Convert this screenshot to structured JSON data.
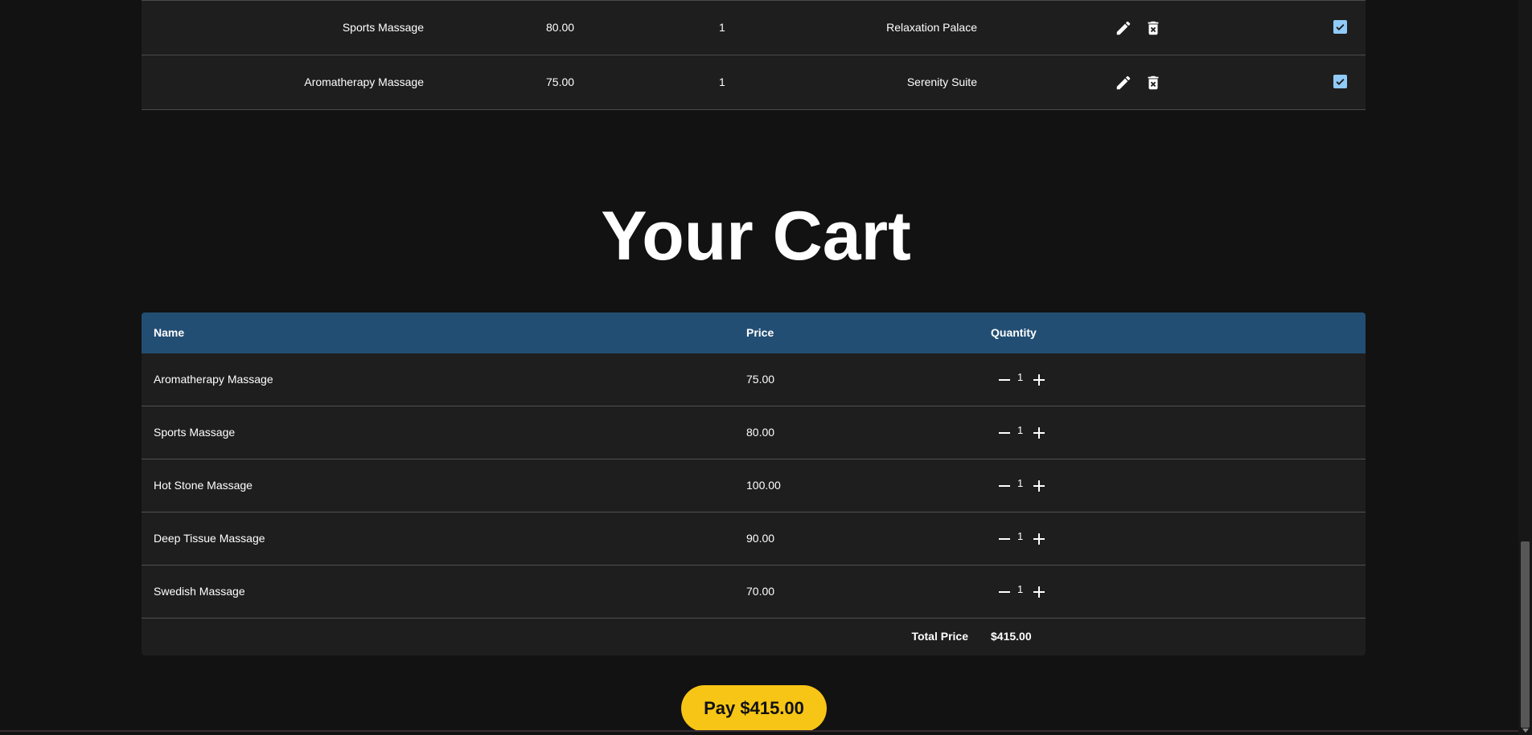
{
  "admin_table": {
    "rows": [
      {
        "name": "Sports Massage",
        "price": "80.00",
        "quantity": "1",
        "location": "Relaxation Palace",
        "checked": true
      },
      {
        "name": "Aromatherapy Massage",
        "price": "75.00",
        "quantity": "1",
        "location": "Serenity Suite",
        "checked": true
      }
    ]
  },
  "cart": {
    "title": "Your Cart",
    "headers": {
      "name": "Name",
      "price": "Price",
      "quantity": "Quantity"
    },
    "items": [
      {
        "name": "Aromatherapy Massage",
        "price": "75.00",
        "quantity": "1"
      },
      {
        "name": "Sports Massage",
        "price": "80.00",
        "quantity": "1"
      },
      {
        "name": "Hot Stone Massage",
        "price": "100.00",
        "quantity": "1"
      },
      {
        "name": "Deep Tissue Massage",
        "price": "90.00",
        "quantity": "1"
      },
      {
        "name": "Swedish Massage",
        "price": "70.00",
        "quantity": "1"
      }
    ],
    "total_label": "Total Price",
    "total_value": "$415.00",
    "pay_label": "Pay $415.00"
  },
  "icons": {
    "edit": "pencil-icon",
    "delete": "trash-icon",
    "checkbox": "checkbox-checked-icon",
    "decrease": "minus-icon",
    "increase": "plus-icon"
  },
  "colors": {
    "background": "#121212",
    "table_background": "#1e1e1e",
    "header_background": "#234e73",
    "checkbox": "#90caf9",
    "pay_button": "#f6c515"
  }
}
